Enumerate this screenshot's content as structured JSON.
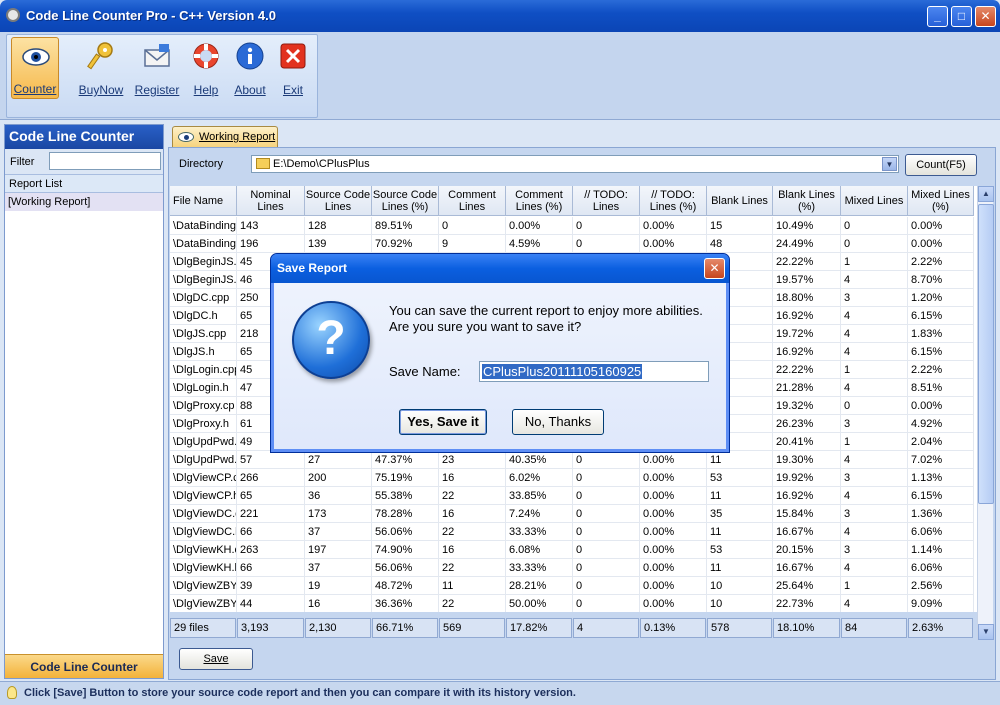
{
  "window": {
    "title": "Code Line Counter Pro - C++ Version 4.0",
    "minimize": "_",
    "maximize": "□",
    "close": "✕"
  },
  "toolbar": [
    {
      "label": "Counter",
      "icon": "eye-icon"
    },
    {
      "label": "BuyNow",
      "icon": "key-icon"
    },
    {
      "label": "Register",
      "icon": "envelope-icon"
    },
    {
      "label": "Help",
      "icon": "lifebuoy-icon"
    },
    {
      "label": "About",
      "icon": "info-icon"
    },
    {
      "label": "Exit",
      "icon": "exit-icon"
    }
  ],
  "sidebar": {
    "title": "Code Line Counter",
    "filter_label": "Filter",
    "filter_value": "",
    "list_header": "Report List",
    "items": [
      "[Working Report]"
    ],
    "footer": "Code Line Counter"
  },
  "tab": {
    "label": "Working Report"
  },
  "directory": {
    "label": "Directory",
    "value": "E:\\Demo\\CPlusPlus",
    "dropdown": "▼",
    "count_button": "Count(F5)"
  },
  "grid": {
    "columns": [
      {
        "label": "File Name",
        "width": 67
      },
      {
        "label": "Nominal Lines",
        "width": 68
      },
      {
        "label": "Source Code Lines",
        "width": 67
      },
      {
        "label": "Source Code Lines (%)",
        "width": 67
      },
      {
        "label": "Comment Lines",
        "width": 67
      },
      {
        "label": "Comment Lines (%)",
        "width": 67
      },
      {
        "label": "// TODO: Lines",
        "width": 67
      },
      {
        "label": "// TODO: Lines (%)",
        "width": 67
      },
      {
        "label": "Blank Lines",
        "width": 66
      },
      {
        "label": "Blank Lines (%)",
        "width": 68
      },
      {
        "label": "Mixed Lines",
        "width": 67
      },
      {
        "label": "Mixed Lines (%)",
        "width": 66
      }
    ],
    "rows": [
      [
        "\\DataBinding",
        "143",
        "128",
        "89.51%",
        "0",
        "0.00%",
        "0",
        "0.00%",
        "15",
        "10.49%",
        "0",
        "0.00%"
      ],
      [
        "\\DataBinding",
        "196",
        "139",
        "70.92%",
        "9",
        "4.59%",
        "0",
        "0.00%",
        "48",
        "24.49%",
        "0",
        "0.00%"
      ],
      [
        "\\DlgBeginJS.c",
        "45",
        "",
        "",
        "",
        "",
        "",
        "",
        "",
        "22.22%",
        "1",
        "2.22%"
      ],
      [
        "\\DlgBeginJS.h",
        "46",
        "",
        "",
        "",
        "",
        "",
        "",
        "",
        "19.57%",
        "4",
        "8.70%"
      ],
      [
        "\\DlgDC.cpp",
        "250",
        "",
        "",
        "",
        "",
        "",
        "",
        "",
        "18.80%",
        "3",
        "1.20%"
      ],
      [
        "\\DlgDC.h",
        "65",
        "",
        "",
        "",
        "",
        "",
        "",
        "",
        "16.92%",
        "4",
        "6.15%"
      ],
      [
        "\\DlgJS.cpp",
        "218",
        "",
        "",
        "",
        "",
        "",
        "",
        "",
        "19.72%",
        "4",
        "1.83%"
      ],
      [
        "\\DlgJS.h",
        "65",
        "",
        "",
        "",
        "",
        "",
        "",
        "",
        "16.92%",
        "4",
        "6.15%"
      ],
      [
        "\\DlgLogin.cpp",
        "45",
        "",
        "",
        "",
        "",
        "",
        "",
        "",
        "22.22%",
        "1",
        "2.22%"
      ],
      [
        "\\DlgLogin.h",
        "47",
        "",
        "",
        "",
        "",
        "",
        "",
        "",
        "21.28%",
        "4",
        "8.51%"
      ],
      [
        "\\DlgProxy.cp",
        "88",
        "",
        "",
        "",
        "",
        "",
        "",
        "",
        "19.32%",
        "0",
        "0.00%"
      ],
      [
        "\\DlgProxy.h",
        "61",
        "",
        "",
        "",
        "",
        "",
        "",
        "",
        "26.23%",
        "3",
        "4.92%"
      ],
      [
        "\\DlgUpdPwd.",
        "49",
        "",
        "",
        "",
        "",
        "",
        "",
        "",
        "20.41%",
        "1",
        "2.04%"
      ],
      [
        "\\DlgUpdPwd.",
        "57",
        "27",
        "47.37%",
        "23",
        "40.35%",
        "0",
        "0.00%",
        "11",
        "19.30%",
        "4",
        "7.02%"
      ],
      [
        "\\DlgViewCP.c",
        "266",
        "200",
        "75.19%",
        "16",
        "6.02%",
        "0",
        "0.00%",
        "53",
        "19.92%",
        "3",
        "1.13%"
      ],
      [
        "\\DlgViewCP.h",
        "65",
        "36",
        "55.38%",
        "22",
        "33.85%",
        "0",
        "0.00%",
        "11",
        "16.92%",
        "4",
        "6.15%"
      ],
      [
        "\\DlgViewDC.c",
        "221",
        "173",
        "78.28%",
        "16",
        "7.24%",
        "0",
        "0.00%",
        "35",
        "15.84%",
        "3",
        "1.36%"
      ],
      [
        "\\DlgViewDC.h",
        "66",
        "37",
        "56.06%",
        "22",
        "33.33%",
        "0",
        "0.00%",
        "11",
        "16.67%",
        "4",
        "6.06%"
      ],
      [
        "\\DlgViewKH.c",
        "263",
        "197",
        "74.90%",
        "16",
        "6.08%",
        "0",
        "0.00%",
        "53",
        "20.15%",
        "3",
        "1.14%"
      ],
      [
        "\\DlgViewKH.h",
        "66",
        "37",
        "56.06%",
        "22",
        "33.33%",
        "0",
        "0.00%",
        "11",
        "16.67%",
        "4",
        "6.06%"
      ],
      [
        "\\DlgViewZBY.",
        "39",
        "19",
        "48.72%",
        "11",
        "28.21%",
        "0",
        "0.00%",
        "10",
        "25.64%",
        "1",
        "2.56%"
      ],
      [
        "\\DlgViewZBY.",
        "44",
        "16",
        "36.36%",
        "22",
        "50.00%",
        "0",
        "0.00%",
        "10",
        "22.73%",
        "4",
        "9.09%"
      ]
    ],
    "totals": [
      "29 files",
      "3,193",
      "2,130",
      "66.71%",
      "569",
      "17.82%",
      "4",
      "0.13%",
      "578",
      "18.10%",
      "84",
      "2.63%"
    ]
  },
  "save_button": "Save",
  "status": "Click [Save] Button to store your source code report and then you can compare it with its history version.",
  "dialog": {
    "title": "Save Report",
    "message": "You can save the current report to enjoy more abilities. Are you sure you want to save it?",
    "name_label": "Save Name:",
    "name_value": "CPlusPlus20111105160925",
    "yes_button": "Yes, Save it",
    "no_button": "No, Thanks"
  }
}
